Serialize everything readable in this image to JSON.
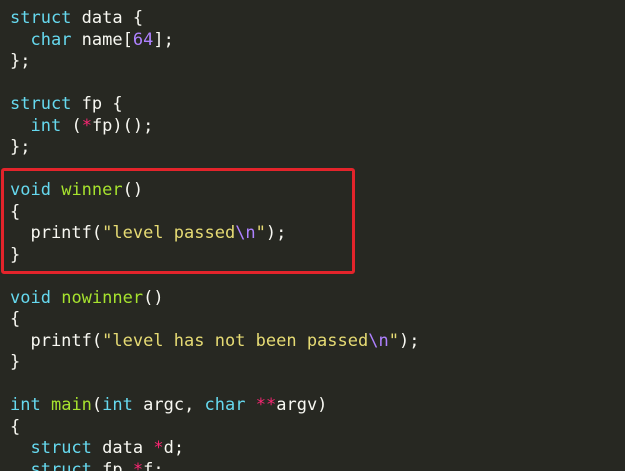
{
  "theme": {
    "background": "#272822",
    "keyword": "#66d9ef",
    "plain": "#f8f8f2",
    "function": "#a6e22e",
    "string": "#e6db74",
    "escape": "#ae81ff",
    "number": "#ae81ff",
    "operator": "#f92672",
    "highlight": "#e3242b"
  },
  "lines": [
    [
      {
        "t": "struct",
        "c": "keyword"
      },
      {
        "t": " data {",
        "c": "plain"
      }
    ],
    [
      {
        "t": "  ",
        "c": "plain"
      },
      {
        "t": "char",
        "c": "keyword"
      },
      {
        "t": " name[",
        "c": "plain"
      },
      {
        "t": "64",
        "c": "number"
      },
      {
        "t": "];",
        "c": "plain"
      }
    ],
    [
      {
        "t": "};",
        "c": "plain"
      }
    ],
    [],
    [
      {
        "t": "struct",
        "c": "keyword"
      },
      {
        "t": " fp {",
        "c": "plain"
      }
    ],
    [
      {
        "t": "  ",
        "c": "plain"
      },
      {
        "t": "int",
        "c": "keyword"
      },
      {
        "t": " (",
        "c": "plain"
      },
      {
        "t": "*",
        "c": "operator"
      },
      {
        "t": "fp)();",
        "c": "plain"
      }
    ],
    [
      {
        "t": "};",
        "c": "plain"
      }
    ],
    [],
    [
      {
        "t": "void",
        "c": "keyword"
      },
      {
        "t": " ",
        "c": "plain"
      },
      {
        "t": "winner",
        "c": "function"
      },
      {
        "t": "()",
        "c": "plain"
      }
    ],
    [
      {
        "t": "{",
        "c": "plain"
      }
    ],
    [
      {
        "t": "  printf(",
        "c": "plain"
      },
      {
        "t": "\"level passed",
        "c": "string"
      },
      {
        "t": "\\n",
        "c": "escape"
      },
      {
        "t": "\"",
        "c": "string"
      },
      {
        "t": ");",
        "c": "plain"
      }
    ],
    [
      {
        "t": "}",
        "c": "plain"
      }
    ],
    [],
    [
      {
        "t": "void",
        "c": "keyword"
      },
      {
        "t": " ",
        "c": "plain"
      },
      {
        "t": "nowinner",
        "c": "function"
      },
      {
        "t": "()",
        "c": "plain"
      }
    ],
    [
      {
        "t": "{",
        "c": "plain"
      }
    ],
    [
      {
        "t": "  printf(",
        "c": "plain"
      },
      {
        "t": "\"level has not been passed",
        "c": "string"
      },
      {
        "t": "\\n",
        "c": "escape"
      },
      {
        "t": "\"",
        "c": "string"
      },
      {
        "t": ");",
        "c": "plain"
      }
    ],
    [
      {
        "t": "}",
        "c": "plain"
      }
    ],
    [],
    [
      {
        "t": "int",
        "c": "keyword"
      },
      {
        "t": " ",
        "c": "plain"
      },
      {
        "t": "main",
        "c": "function"
      },
      {
        "t": "(",
        "c": "plain"
      },
      {
        "t": "int",
        "c": "keyword"
      },
      {
        "t": " argc, ",
        "c": "plain"
      },
      {
        "t": "char",
        "c": "keyword"
      },
      {
        "t": " ",
        "c": "plain"
      },
      {
        "t": "**",
        "c": "operator"
      },
      {
        "t": "argv)",
        "c": "plain"
      }
    ],
    [
      {
        "t": "{",
        "c": "plain"
      }
    ],
    [
      {
        "t": "  ",
        "c": "plain"
      },
      {
        "t": "struct",
        "c": "keyword"
      },
      {
        "t": " data ",
        "c": "plain"
      },
      {
        "t": "*",
        "c": "operator"
      },
      {
        "t": "d;",
        "c": "plain"
      }
    ],
    [
      {
        "t": "  ",
        "c": "plain"
      },
      {
        "t": "struct",
        "c": "keyword"
      },
      {
        "t": " fp ",
        "c": "plain"
      },
      {
        "t": "*",
        "c": "operator"
      },
      {
        "t": "f;",
        "c": "plain"
      }
    ]
  ]
}
